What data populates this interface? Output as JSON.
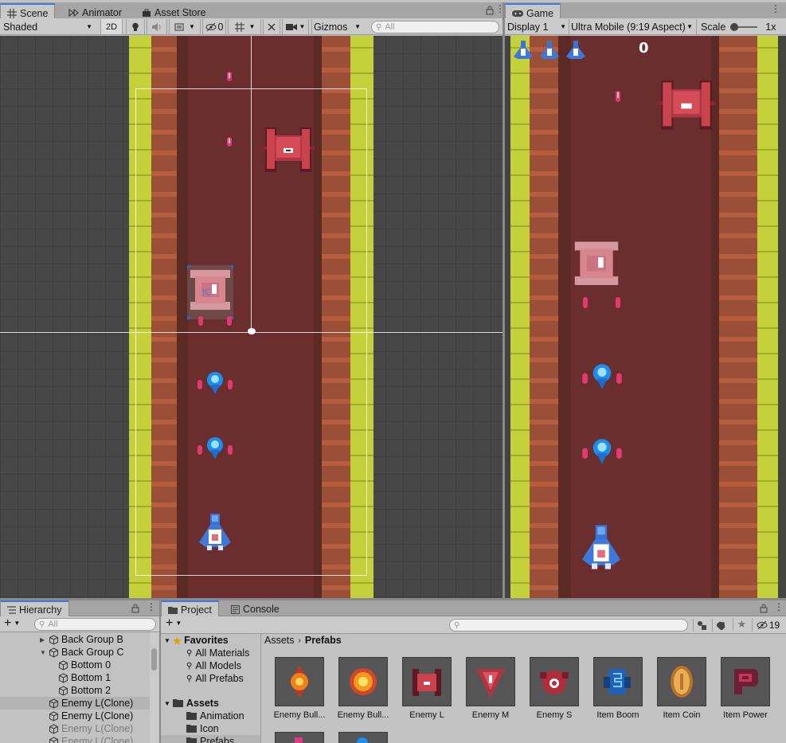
{
  "scene_tabs": {
    "scene": "Scene",
    "animator": "Animator",
    "asset_store": "Asset Store"
  },
  "scene_toolbar": {
    "shading_mode": "Shaded",
    "mode_2d": "2D",
    "hidden_count": "0",
    "gizmos": "Gizmos",
    "search_placeholder": "All"
  },
  "game_tab": {
    "label": "Game"
  },
  "game_toolbar": {
    "display": "Display 1",
    "aspect": "Ultra Mobile (9:19 Aspect)",
    "scale_label": "Scale",
    "scale_value": "1x"
  },
  "game_view": {
    "score": "0",
    "lives": 3
  },
  "hierarchy": {
    "tab": "Hierarchy",
    "search_placeholder": "All",
    "items": [
      {
        "label": "Back Group B",
        "indent": 1,
        "fold": "right",
        "state": "normal"
      },
      {
        "label": "Back Group C",
        "indent": 1,
        "fold": "down",
        "state": "normal"
      },
      {
        "label": "Bottom 0",
        "indent": 2,
        "fold": "",
        "state": "normal"
      },
      {
        "label": "Bottom 1",
        "indent": 2,
        "fold": "",
        "state": "normal"
      },
      {
        "label": "Bottom 2",
        "indent": 2,
        "fold": "",
        "state": "normal"
      },
      {
        "label": "Enemy L(Clone)",
        "indent": 0,
        "fold": "",
        "state": "selected"
      },
      {
        "label": "Enemy L(Clone)",
        "indent": 0,
        "fold": "",
        "state": "normal"
      },
      {
        "label": "Enemy L(Clone)",
        "indent": 0,
        "fold": "",
        "state": "dim"
      },
      {
        "label": "Enemy L(Clone)",
        "indent": 0,
        "fold": "",
        "state": "dim"
      }
    ]
  },
  "project": {
    "tab_project": "Project",
    "tab_console": "Console",
    "hidden_count": "19",
    "favorites_label": "Favorites",
    "favorites": [
      "All Materials",
      "All Models",
      "All Prefabs"
    ],
    "assets_label": "Assets",
    "folders": [
      "Animation",
      "Icon",
      "Prefabs"
    ],
    "breadcrumb_root": "Assets",
    "breadcrumb_current": "Prefabs",
    "prefabs": [
      {
        "label": "Enemy Bull...",
        "icon": "orange-bullet-icon"
      },
      {
        "label": "Enemy Bull...",
        "icon": "gold-bullet-icon"
      },
      {
        "label": "Enemy L",
        "icon": "large-enemy-icon"
      },
      {
        "label": "Enemy M",
        "icon": "medium-enemy-icon"
      },
      {
        "label": "Enemy S",
        "icon": "small-enemy-icon"
      },
      {
        "label": "Item Boom",
        "icon": "boom-item-icon"
      },
      {
        "label": "Item Coin",
        "icon": "coin-item-icon"
      },
      {
        "label": "Item Power",
        "icon": "power-item-icon"
      }
    ]
  }
}
